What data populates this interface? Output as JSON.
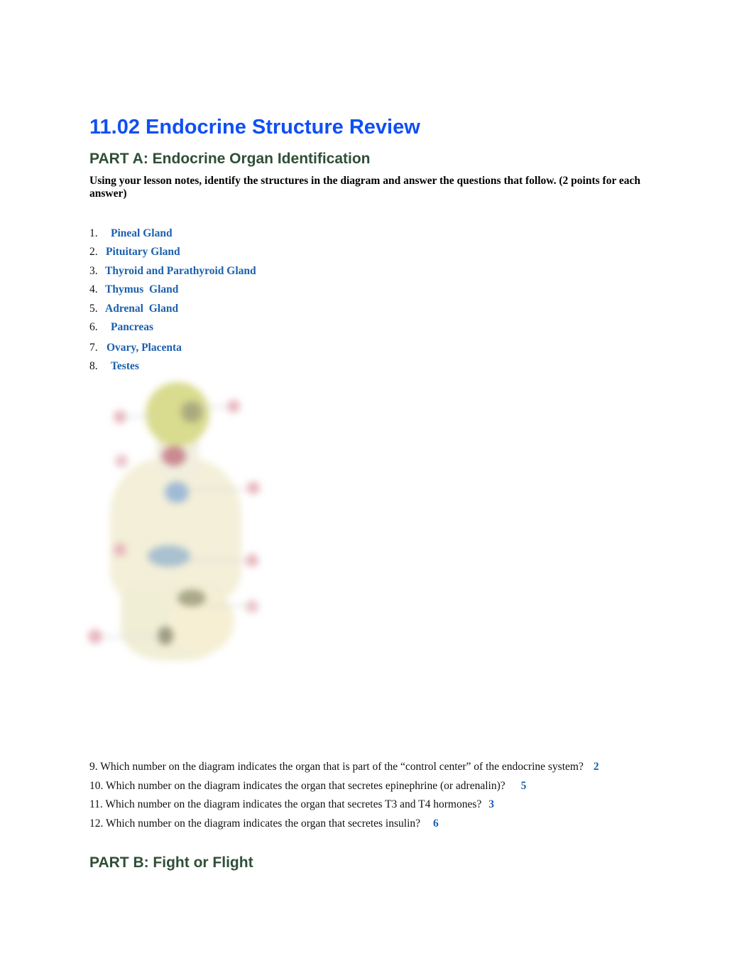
{
  "document": {
    "title": "11.02 Endocrine Structure Review",
    "part_a": {
      "heading": "PART A: Endocrine Organ Identification",
      "instructions": "Using your lesson notes, identify the structures in the diagram and answer the questions that follow. (2 points for each answer)",
      "answers": [
        {
          "number": "1.",
          "answer": "Pineal Gland"
        },
        {
          "number": "2.",
          "answer": "Pituitary Gland"
        },
        {
          "number": "3.",
          "answer": "Thyroid and Parathyroid Gland"
        },
        {
          "number": "4.",
          "answer": "Thymus  Gland"
        },
        {
          "number": "5.",
          "answer": "Adrenal  Gland"
        },
        {
          "number": "6.",
          "answer": "Pancreas"
        },
        {
          "number": "7.",
          "answer": "Ovary, Placenta"
        },
        {
          "number": "8.",
          "answer": "Testes"
        }
      ],
      "diagram": {
        "description": "Blurred endocrine system diagram of human body with numbered labels",
        "colors": {
          "body": "#f3efd8",
          "head": "#d9db8e",
          "thyroid": "#c98a90",
          "thymus": "#9fbad6",
          "label": "#e8b6bd",
          "organ_dark": "#a9a889"
        }
      },
      "questions": [
        {
          "text": "9. Which number on the diagram indicates the organ that is part of the “control center” of the endocrine system?",
          "answer": "2"
        },
        {
          "text": "10. Which number on the diagram indicates the organ that secretes epinephrine (or adrenalin)?",
          "answer": "5"
        },
        {
          "text": "11. Which number on the diagram indicates the organ that secretes T3 and T4 hormones?",
          "answer": "3"
        },
        {
          "text": "12. Which number on the diagram indicates the organ that secretes insulin?",
          "answer": "6"
        }
      ]
    },
    "part_b": {
      "heading": "PART B: Fight or Flight"
    },
    "colors": {
      "title": "#0f4ff5",
      "heading": "#2f4f36",
      "answer": "#1b5fad"
    }
  }
}
